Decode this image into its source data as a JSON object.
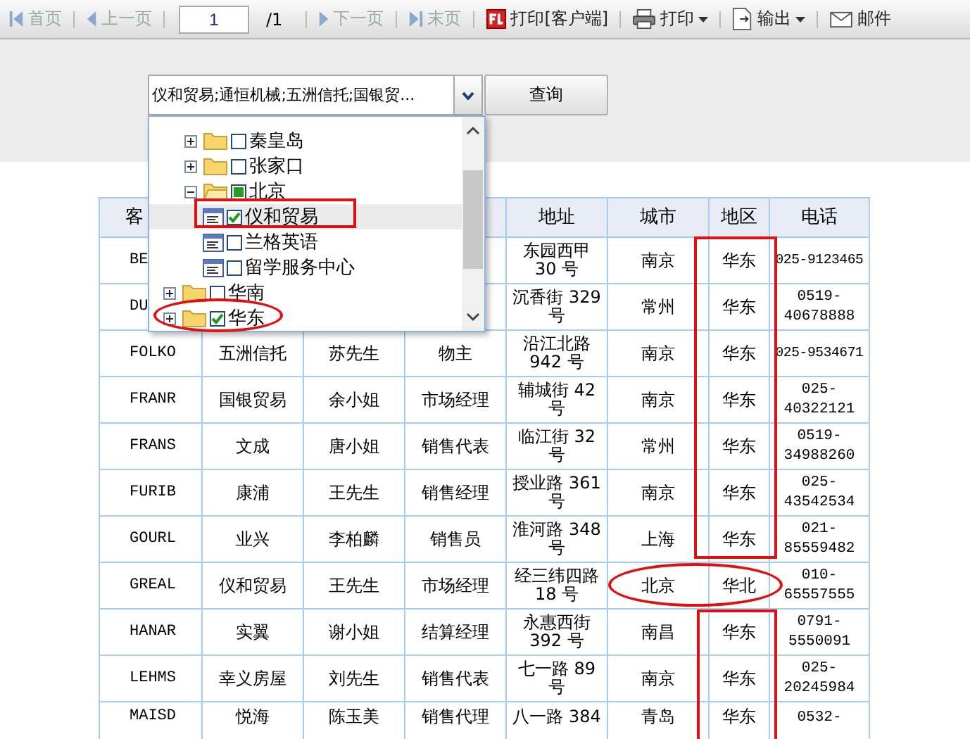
{
  "toolbar": {
    "nav_left": [
      {
        "kind": "first",
        "label": "首页",
        "disabled": true
      },
      {
        "kind": "prev",
        "label": "上一页",
        "disabled": true
      }
    ],
    "page": {
      "value": "1",
      "total": "/1"
    },
    "nav_right": [
      {
        "kind": "next",
        "label": "下一页",
        "disabled": true
      },
      {
        "kind": "last",
        "label": "末页",
        "disabled": true
      }
    ],
    "actions": [
      {
        "kind": "print_client",
        "label": "打印[客户端]",
        "menu": false
      },
      {
        "kind": "print",
        "label": "打印",
        "menu": true
      },
      {
        "kind": "export",
        "label": "输出",
        "menu": true
      },
      {
        "kind": "mail",
        "label": "邮件",
        "menu": false
      }
    ]
  },
  "filter": {
    "value": "仪和贸易;通恒机械;五洲信托;国银贸...",
    "button": "查询",
    "tree": [
      {
        "children": [
          {
            "kind": "folder",
            "label": "秦皇岛",
            "checked": false,
            "partial": false,
            "expanded": false,
            "selected": false
          },
          {
            "kind": "folder",
            "label": "张家口",
            "checked": false,
            "partial": false,
            "expanded": false,
            "selected": false
          },
          {
            "kind": "folder",
            "label": "北京",
            "checked": false,
            "partial": true,
            "expanded": true,
            "selected": false,
            "children": [
              {
                "kind": "leaf",
                "label": "仪和贸易",
                "checked": true,
                "partial": false,
                "selected": true
              },
              {
                "kind": "leaf",
                "label": "兰格英语",
                "checked": false,
                "partial": false,
                "selected": false
              },
              {
                "kind": "leaf",
                "label": "留学服务中心",
                "checked": false,
                "partial": false,
                "selected": false
              }
            ]
          }
        ]
      },
      {
        "kind": "folder",
        "label": "华南",
        "checked": false,
        "partial": false,
        "expanded": false,
        "selected": false
      },
      {
        "kind": "folder",
        "label": "华东",
        "checked": true,
        "partial": false,
        "expanded": false,
        "selected": false
      }
    ]
  },
  "table": {
    "columns": [
      "客",
      null,
      null,
      null,
      "地址",
      "城市",
      "地区",
      "电话"
    ],
    "rows": [
      {
        "cells": [
          "BE",
          null,
          null,
          null,
          "东园西甲 30 号",
          "南京",
          "华东",
          "025-9123465"
        ]
      },
      {
        "cells": [
          "DU",
          null,
          null,
          null,
          "沉香街 329 号",
          "常州",
          "华东",
          "0519-40678888"
        ]
      },
      {
        "cells": [
          "FOLKO",
          "五洲信托",
          "苏先生",
          "物主",
          "沿江北路 942 号",
          "南京",
          "华东",
          "025-9534671"
        ]
      },
      {
        "cells": [
          "FRANR",
          "国银贸易",
          "余小姐",
          "市场经理",
          "辅城街 42 号",
          "南京",
          "华东",
          "025-40322121"
        ]
      },
      {
        "cells": [
          "FRANS",
          "文成",
          "唐小姐",
          "销售代表",
          "临江街 32 号",
          "常州",
          "华东",
          "0519-34988260"
        ]
      },
      {
        "cells": [
          "FURIB",
          "康浦",
          "王先生",
          "销售经理",
          "授业路 361 号",
          "南京",
          "华东",
          "025-43542534"
        ]
      },
      {
        "cells": [
          "GOURL",
          "业兴",
          "李柏麟",
          "销售员",
          "淮河路 348 号",
          "上海",
          "华东",
          "021-85559482"
        ]
      },
      {
        "cells": [
          "GREAL",
          "仪和贸易",
          "王先生",
          "市场经理",
          "经三纬四路 18 号",
          "北京",
          "华北",
          "010-65557555"
        ]
      },
      {
        "cells": [
          "HANAR",
          "实翼",
          "谢小姐",
          "结算经理",
          "永惠西街 392 号",
          "南昌",
          "华东",
          "0791-5550091"
        ]
      },
      {
        "cells": [
          "LEHMS",
          "幸义房屋",
          "刘先生",
          "销售代表",
          "七一路 89 号",
          "南京",
          "华东",
          "025-20245984"
        ]
      },
      {
        "cells": [
          "MAISD",
          "悦海",
          "陈玉美",
          "销售代理",
          "八一路 384",
          "青岛",
          "华东",
          "0532-"
        ]
      }
    ]
  }
}
